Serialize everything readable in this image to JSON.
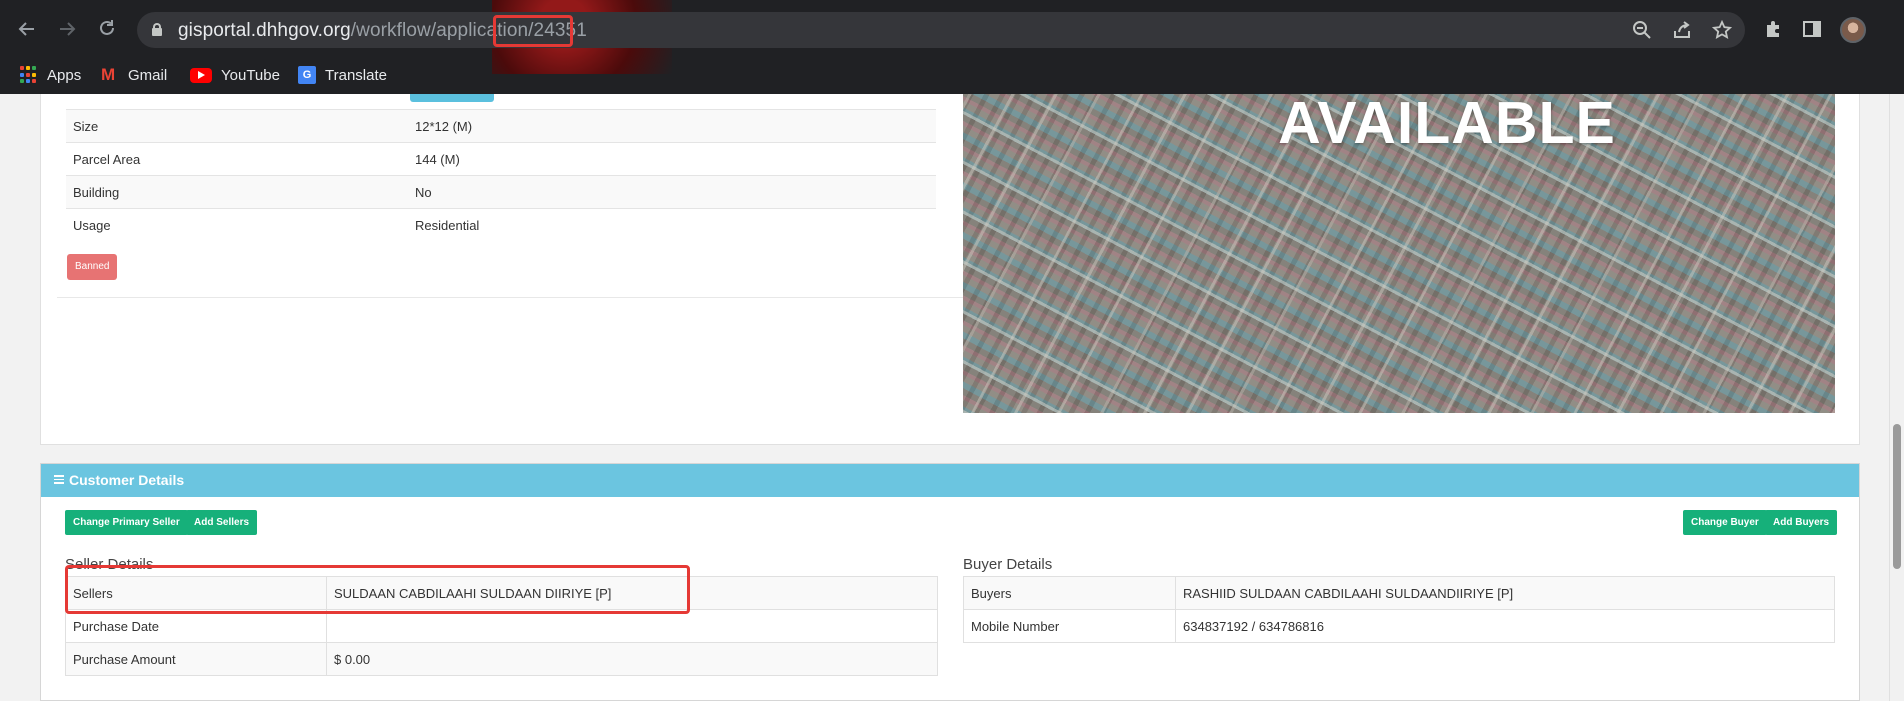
{
  "browser": {
    "url_host": "gisportal.dhhgov.org",
    "url_path": "/workflow/application",
    "url_id": "/24351",
    "bookmarks": [
      "Apps",
      "Gmail",
      "YouTube",
      "Translate"
    ],
    "icons": {
      "back": "arrow-left-icon",
      "forward": "arrow-right-icon",
      "reload": "reload-icon",
      "zoom": "zoom-out-icon",
      "share": "share-icon",
      "bookmark": "star-icon",
      "extensions": "puzzle-icon",
      "sidepanel": "side-panel-icon"
    }
  },
  "parcel": {
    "rows": [
      {
        "label": "Size",
        "value": "12*12 (M)"
      },
      {
        "label": "Parcel Area",
        "value": "144 (M)"
      },
      {
        "label": "Building",
        "value": "No"
      },
      {
        "label": "Usage",
        "value": "Residential"
      }
    ],
    "status_badge": "Banned",
    "image_text": "AVAILABLE"
  },
  "customer": {
    "title": "Customer Details",
    "buttons": {
      "change_primary_seller": "Change Primary Seller",
      "add_sellers": "Add Sellers",
      "change_buyer": "Change Buyer",
      "add_buyers": "Add Buyers"
    },
    "seller": {
      "heading": "Seller Details",
      "rows": [
        {
          "label": "Sellers",
          "value": "SULDAAN CABDILAAHI SULDAAN DIIRIYE [P]"
        },
        {
          "label": "Purchase Date",
          "value": ""
        },
        {
          "label": "Purchase Amount",
          "value": "$ 0.00"
        }
      ]
    },
    "buyer": {
      "heading": "Buyer Details",
      "rows": [
        {
          "label": "Buyers",
          "value": "RASHIID SULDAAN CABDILAAHI SULDAANDIIRIYE [P]"
        },
        {
          "label": "Mobile Number",
          "value": "634837192 / 634786816"
        }
      ]
    }
  },
  "colors": {
    "header_blue": "#6bc5e0",
    "button_green": "#16b07a",
    "badge_red": "#e77373",
    "highlight_red": "#e53935"
  }
}
